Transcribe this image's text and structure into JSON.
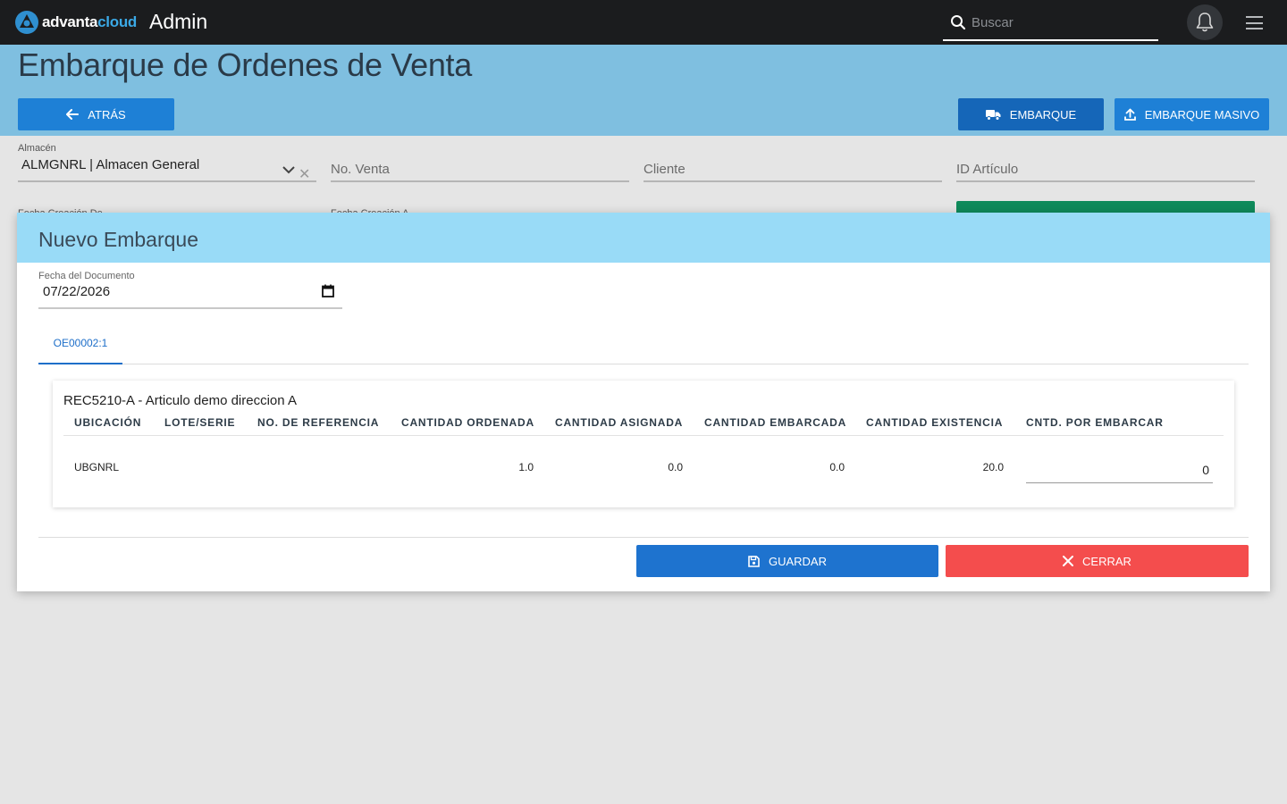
{
  "topbar": {
    "logo_text_a": "advanta",
    "logo_text_b": "cloud",
    "app_title": "Admin",
    "search_placeholder": "Buscar",
    "icons": [
      "search-icon",
      "bell-icon",
      "hamburger-menu-icon"
    ]
  },
  "header": {
    "title": "Embarque de Ordenes de Venta",
    "back_label": "ATRÁS",
    "embarque_label": "EMBARQUE",
    "masivo_label": "EMBARQUE MASIVO"
  },
  "filters": {
    "almacen_label": "Almacén",
    "almacen_value": "ALMGNRL | Almacen General",
    "venta_placeholder": "No. Venta",
    "cliente_placeholder": "Cliente",
    "articulo_placeholder": "ID Artículo",
    "fecha_de_label": "Fecha Creación De",
    "fecha_a_label": "Fecha Creación A"
  },
  "modal": {
    "title": "Nuevo Embarque",
    "date_label": "Fecha del Documento",
    "date_value": "07/22/2026",
    "tab_label": "OE00002:1",
    "item_title": "REC5210-A - Articulo demo direccion A",
    "columns": [
      "UBICACIÓN",
      "LOTE/SERIE",
      "NO. DE REFERENCIA",
      "CANTIDAD ORDENADA",
      "CANTIDAD ASIGNADA",
      "CANTIDAD EMBARCADA",
      "CANTIDAD EXISTENCIA",
      "CNTD. POR EMBARCAR"
    ],
    "row": {
      "ubicacion": "UBGNRL",
      "lote": "",
      "referencia": "",
      "ordenada": "1.0",
      "asignada": "0.0",
      "embarcada": "0.0",
      "existencia": "20.0",
      "por_embarcar": "0"
    },
    "save_label": "GUARDAR",
    "close_label": "CERRAR"
  },
  "colors": {
    "topbar": "#1b1c1e",
    "header": "#7fbfe0",
    "modal_header": "#99dbf7",
    "primary": "#1e80d6",
    "danger": "#f44d4d",
    "success": "#0f8a5b"
  }
}
